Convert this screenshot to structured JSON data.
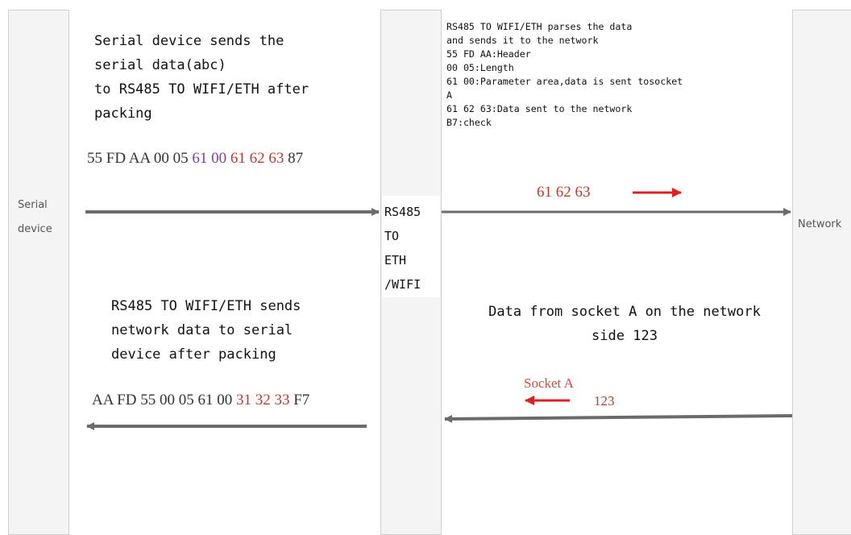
{
  "lanes": {
    "serial": "Serial\ndevice",
    "network": "Network",
    "device": "RS485\nTO\nETH\n/WIFI"
  },
  "serial_send": {
    "text": "Serial device sends the\nserial data(abc)\nto RS485 TO WIFI/ETH after\npacking",
    "hex_tokens": [
      {
        "t": "55",
        "c": "#333333"
      },
      {
        "t": "FD",
        "c": "#333333"
      },
      {
        "t": "AA",
        "c": "#333333"
      },
      {
        "t": "00",
        "c": "#333333"
      },
      {
        "t": "05",
        "c": "#333333"
      },
      {
        "t": "61",
        "c": "#7b3fa0"
      },
      {
        "t": "00",
        "c": "#7b3fa0"
      },
      {
        "t": "61",
        "c": "#c0392b"
      },
      {
        "t": "62",
        "c": "#c0392b"
      },
      {
        "t": "63",
        "c": "#c0392b"
      },
      {
        "t": "87",
        "c": "#333333"
      }
    ]
  },
  "network_parse": {
    "text": "RS485 TO WIFI/ETH parses the data\nand sends it to the network\n55 FD AA:Header\n00 05:Length\n61 00:Parameter area,data is sent tosocket\nA\n61 62 63:Data sent to the network\nB7:check",
    "sent_label": "61 62 63"
  },
  "socket_side": {
    "text": "Data from socket A on the network\nside 123",
    "socket_label": "Socket A",
    "value_label": "123"
  },
  "serial_recv": {
    "text": "RS485 TO WIFI/ETH sends\nnetwork data to serial\ndevice after packing",
    "hex_tokens": [
      {
        "t": "AA",
        "c": "#333333"
      },
      {
        "t": "FD",
        "c": "#333333"
      },
      {
        "t": "55",
        "c": "#333333"
      },
      {
        "t": "00",
        "c": "#333333"
      },
      {
        "t": "05",
        "c": "#333333"
      },
      {
        "t": "61",
        "c": "#333333"
      },
      {
        "t": "00",
        "c": "#333333"
      },
      {
        "t": "31",
        "c": "#c0392b"
      },
      {
        "t": "32",
        "c": "#c0392b"
      },
      {
        "t": "33",
        "c": "#c0392b"
      },
      {
        "t": "F7",
        "c": "#333333"
      }
    ]
  },
  "colors": {
    "arrow": "#6b6b6b",
    "red_arrow": "#e02020",
    "lane_fill": "#f4f4f4"
  }
}
